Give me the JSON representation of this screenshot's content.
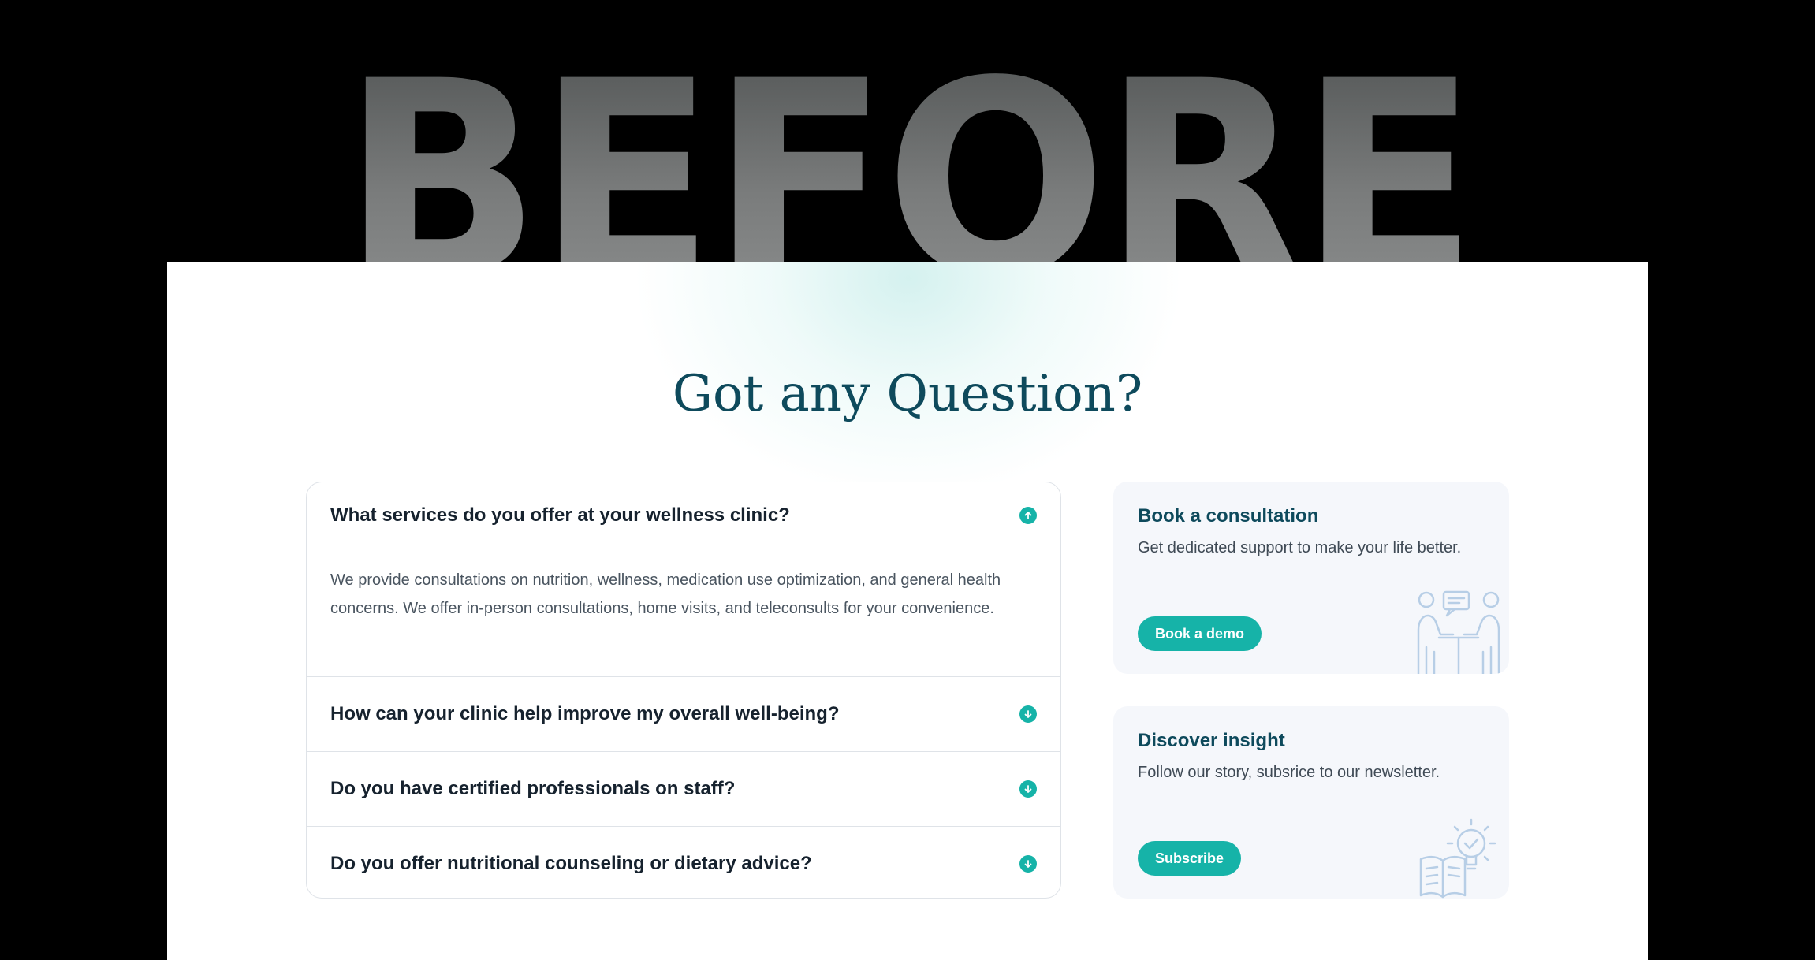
{
  "banner": {
    "word": "BEFORE"
  },
  "section": {
    "heading": "Got any Question?"
  },
  "faq": {
    "items": [
      {
        "question": "What services do you offer at your wellness clinic?",
        "answer": "We provide consultations on nutrition, wellness, medication use optimization, and general health concerns. We offer in-person consultations, home visits, and teleconsults for your convenience.",
        "expanded": true,
        "icon": "arrow-up-circle-icon"
      },
      {
        "question": "How can your clinic help improve my overall well-being?",
        "expanded": false,
        "icon": "arrow-down-circle-icon"
      },
      {
        "question": "Do you have certified professionals on staff?",
        "expanded": false,
        "icon": "arrow-down-circle-icon"
      },
      {
        "question": "Do you offer nutritional counseling or dietary advice?",
        "expanded": false,
        "icon": "arrow-down-circle-icon"
      }
    ]
  },
  "cards": [
    {
      "title": "Book a consultation",
      "text": "Get dedicated support to make your life better.",
      "button": "Book a demo",
      "illustration": "consultation-illustration"
    },
    {
      "title": "Discover insight",
      "text": "Follow our story, subsrice to our newsletter.",
      "button": "Subscribe",
      "illustration": "lightbulb-book-illustration"
    }
  ],
  "colors": {
    "accent": "#16b3a8",
    "heading": "#0e4a5c",
    "text": "#16222e",
    "card_bg": "#f5f7fb"
  }
}
